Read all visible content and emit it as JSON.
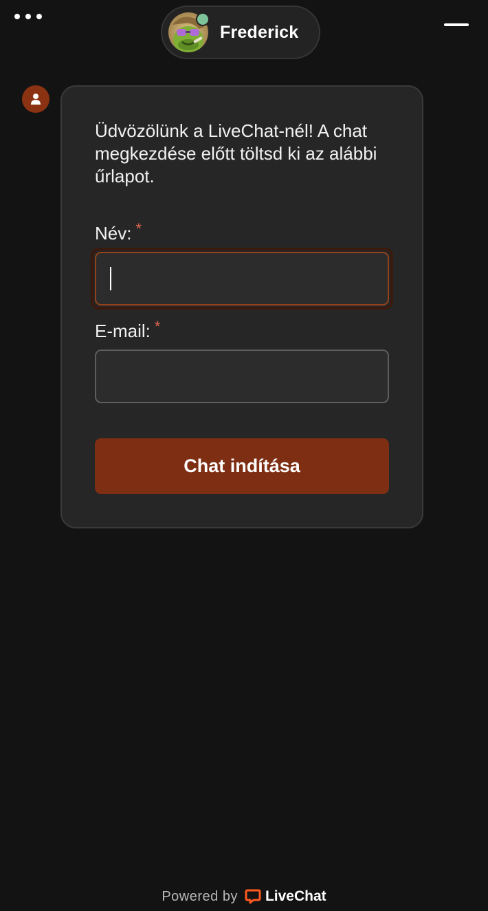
{
  "header": {
    "agent_name": "Frederick",
    "agent_status": "online",
    "status_color": "#7dc49a"
  },
  "message": {
    "welcome": "Üdvözölünk a LiveChat-nél! A chat megkezdése előtt töltsd ki az alábbi űrlapot.",
    "fields": [
      {
        "label": "Név:",
        "required_mark": "*",
        "value": "",
        "focused": true
      },
      {
        "label": "E-mail:",
        "required_mark": "*",
        "value": "",
        "focused": false
      }
    ],
    "submit_label": "Chat indítása"
  },
  "footer": {
    "powered_by": "Powered by",
    "brand": "LiveChat",
    "brand_color": "#ff5a1f"
  },
  "colors": {
    "accent": "#7e2f13",
    "background": "#131313",
    "card": "#262626"
  }
}
